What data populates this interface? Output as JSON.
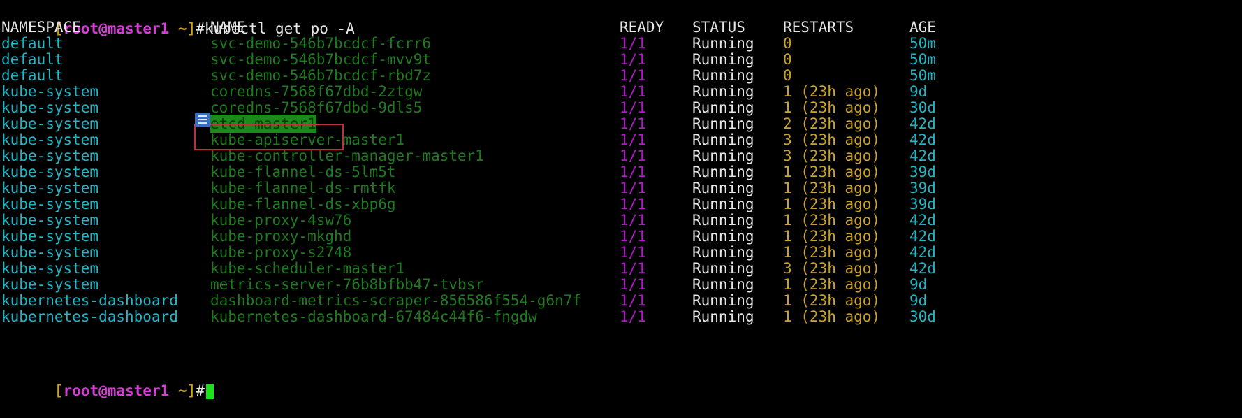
{
  "prompt": {
    "open_bracket": "[",
    "user": "root",
    "at": "@",
    "host": "master1",
    "dir": " ~]",
    "symbol": "#",
    "command": "kubectl get po -A"
  },
  "table": {
    "headers": {
      "namespace": "NAMESPACE",
      "name": "NAME",
      "ready": "READY",
      "status": "STATUS",
      "restarts": "RESTARTS",
      "age": "AGE"
    },
    "rows": [
      {
        "namespace": "default",
        "name": "svc-demo-546b7bcdcf-fcrr6",
        "ready": "1/1",
        "status": "Running",
        "restarts": "0",
        "age": "50m"
      },
      {
        "namespace": "default",
        "name": "svc-demo-546b7bcdcf-mvv9t",
        "ready": "1/1",
        "status": "Running",
        "restarts": "0",
        "age": "50m"
      },
      {
        "namespace": "default",
        "name": "svc-demo-546b7bcdcf-rbd7z",
        "ready": "1/1",
        "status": "Running",
        "restarts": "0",
        "age": "50m"
      },
      {
        "namespace": "kube-system",
        "name": "coredns-7568f67dbd-2ztgw",
        "ready": "1/1",
        "status": "Running",
        "restarts": "1 (23h ago)",
        "age": "9d"
      },
      {
        "namespace": "kube-system",
        "name": "coredns-7568f67dbd-9dls5",
        "ready": "1/1",
        "status": "Running",
        "restarts": "1 (23h ago)",
        "age": "30d"
      },
      {
        "namespace": "kube-system",
        "name": "etcd-master1",
        "ready": "1/1",
        "status": "Running",
        "restarts": "2 (23h ago)",
        "age": "42d"
      },
      {
        "namespace": "kube-system",
        "name": "kube-apiserver-master1",
        "ready": "1/1",
        "status": "Running",
        "restarts": "3 (23h ago)",
        "age": "42d"
      },
      {
        "namespace": "kube-system",
        "name": "kube-controller-manager-master1",
        "ready": "1/1",
        "status": "Running",
        "restarts": "3 (23h ago)",
        "age": "42d"
      },
      {
        "namespace": "kube-system",
        "name": "kube-flannel-ds-5lm5t",
        "ready": "1/1",
        "status": "Running",
        "restarts": "1 (23h ago)",
        "age": "39d"
      },
      {
        "namespace": "kube-system",
        "name": "kube-flannel-ds-rmtfk",
        "ready": "1/1",
        "status": "Running",
        "restarts": "1 (23h ago)",
        "age": "39d"
      },
      {
        "namespace": "kube-system",
        "name": "kube-flannel-ds-xbp6g",
        "ready": "1/1",
        "status": "Running",
        "restarts": "1 (23h ago)",
        "age": "39d"
      },
      {
        "namespace": "kube-system",
        "name": "kube-proxy-4sw76",
        "ready": "1/1",
        "status": "Running",
        "restarts": "1 (23h ago)",
        "age": "42d"
      },
      {
        "namespace": "kube-system",
        "name": "kube-proxy-mkghd",
        "ready": "1/1",
        "status": "Running",
        "restarts": "1 (23h ago)",
        "age": "42d"
      },
      {
        "namespace": "kube-system",
        "name": "kube-proxy-s2748",
        "ready": "1/1",
        "status": "Running",
        "restarts": "1 (23h ago)",
        "age": "42d"
      },
      {
        "namespace": "kube-system",
        "name": "kube-scheduler-master1",
        "ready": "1/1",
        "status": "Running",
        "restarts": "3 (23h ago)",
        "age": "42d"
      },
      {
        "namespace": "kube-system",
        "name": "metrics-server-76b8bfbb47-tvbsr",
        "ready": "1/1",
        "status": "Running",
        "restarts": "1 (23h ago)",
        "age": "9d"
      },
      {
        "namespace": "kubernetes-dashboard",
        "name": "dashboard-metrics-scraper-856586f554-g6n7f",
        "ready": "1/1",
        "status": "Running",
        "restarts": "1 (23h ago)",
        "age": "9d"
      },
      {
        "namespace": "kubernetes-dashboard",
        "name": "kubernetes-dashboard-67484c44f6-fngdw",
        "ready": "1/1",
        "status": "Running",
        "restarts": "1 (23h ago)",
        "age": "30d"
      }
    ]
  },
  "highlighted_row": 5,
  "colors": {
    "namespace": "#1fb5c4",
    "name": "#1f7a1f",
    "ready": "#b218c9",
    "restarts": "#c9a227",
    "age": "#1fb5c4",
    "highlight_box": "#c0303a",
    "cursor": "#1ee01e"
  },
  "icons": {
    "note": "note-icon",
    "cursor": "text-cursor-icon"
  }
}
